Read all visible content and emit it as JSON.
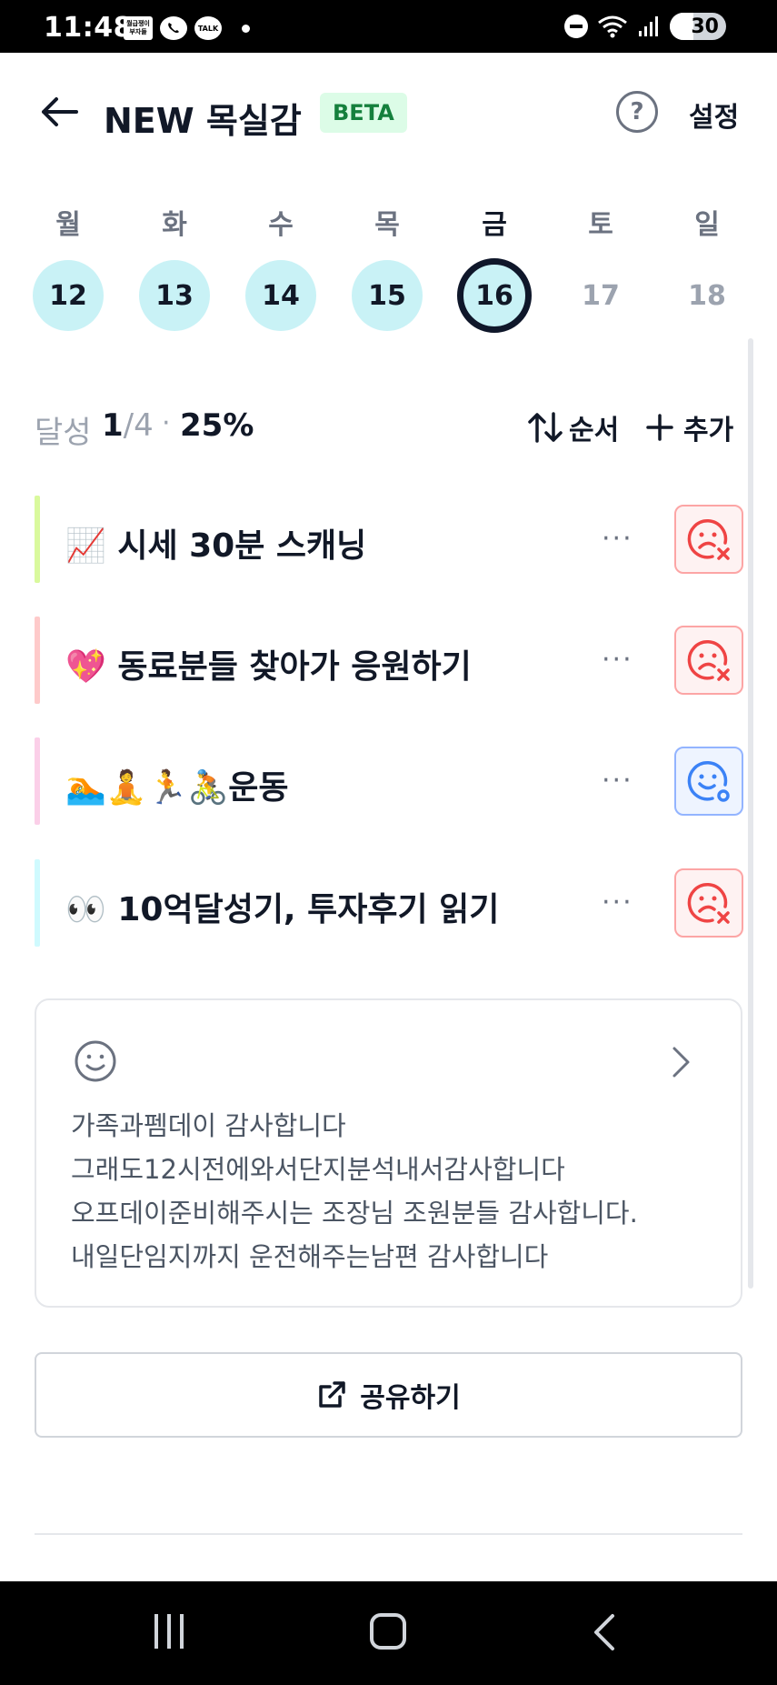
{
  "status_bar": {
    "time": "11:48",
    "notif_app_label": "월급쟁이 부자들",
    "notif_talk_label": "TALK",
    "battery": "30"
  },
  "header": {
    "title": "NEW 목실감",
    "badge": "BETA",
    "help_label": "?",
    "settings_label": "설정"
  },
  "week": {
    "days": [
      {
        "name": "월",
        "date": "12",
        "state": "done"
      },
      {
        "name": "화",
        "date": "13",
        "state": "done"
      },
      {
        "name": "수",
        "date": "14",
        "state": "done"
      },
      {
        "name": "목",
        "date": "15",
        "state": "done"
      },
      {
        "name": "금",
        "date": "16",
        "state": "today"
      },
      {
        "name": "토",
        "date": "17",
        "state": "future"
      },
      {
        "name": "일",
        "date": "18",
        "state": "future"
      }
    ]
  },
  "progress": {
    "label": "달성",
    "done": "1",
    "total": "/4",
    "separator": "·",
    "percent": "25%",
    "order_label": "순서",
    "add_label": "추가"
  },
  "habits": [
    {
      "title": "📈 시세 30분 스캐닝",
      "color": "#d9f99d",
      "status": "fail"
    },
    {
      "title": "💖 동료분들 찾아가 응원하기",
      "color": "#fecaca",
      "status": "fail"
    },
    {
      "title": "🏊🧘🏃🚴운동",
      "color": "#fbcfe8",
      "status": "partial"
    },
    {
      "title": "👀 10억달성기, 투자후기 읽기",
      "color": "#cffafe",
      "status": "fail"
    }
  ],
  "more_label": "···",
  "gratitude": {
    "lines": [
      "가족과펨데이 감사합니다",
      "그래도12시전에와서단지분석내서감사합니다",
      "오프데이준비해주시는 조장님 조원분들 감사합니다.",
      "내일단임지까지 운전해주는남편 감사합니다"
    ]
  },
  "share": {
    "label": "공유하기"
  },
  "colors": {
    "done_circle": "#c9f2f6",
    "fail": "#ef4444",
    "partial": "#3b82f6",
    "beta_bg": "#dcfce7",
    "beta_text": "#15803d"
  }
}
